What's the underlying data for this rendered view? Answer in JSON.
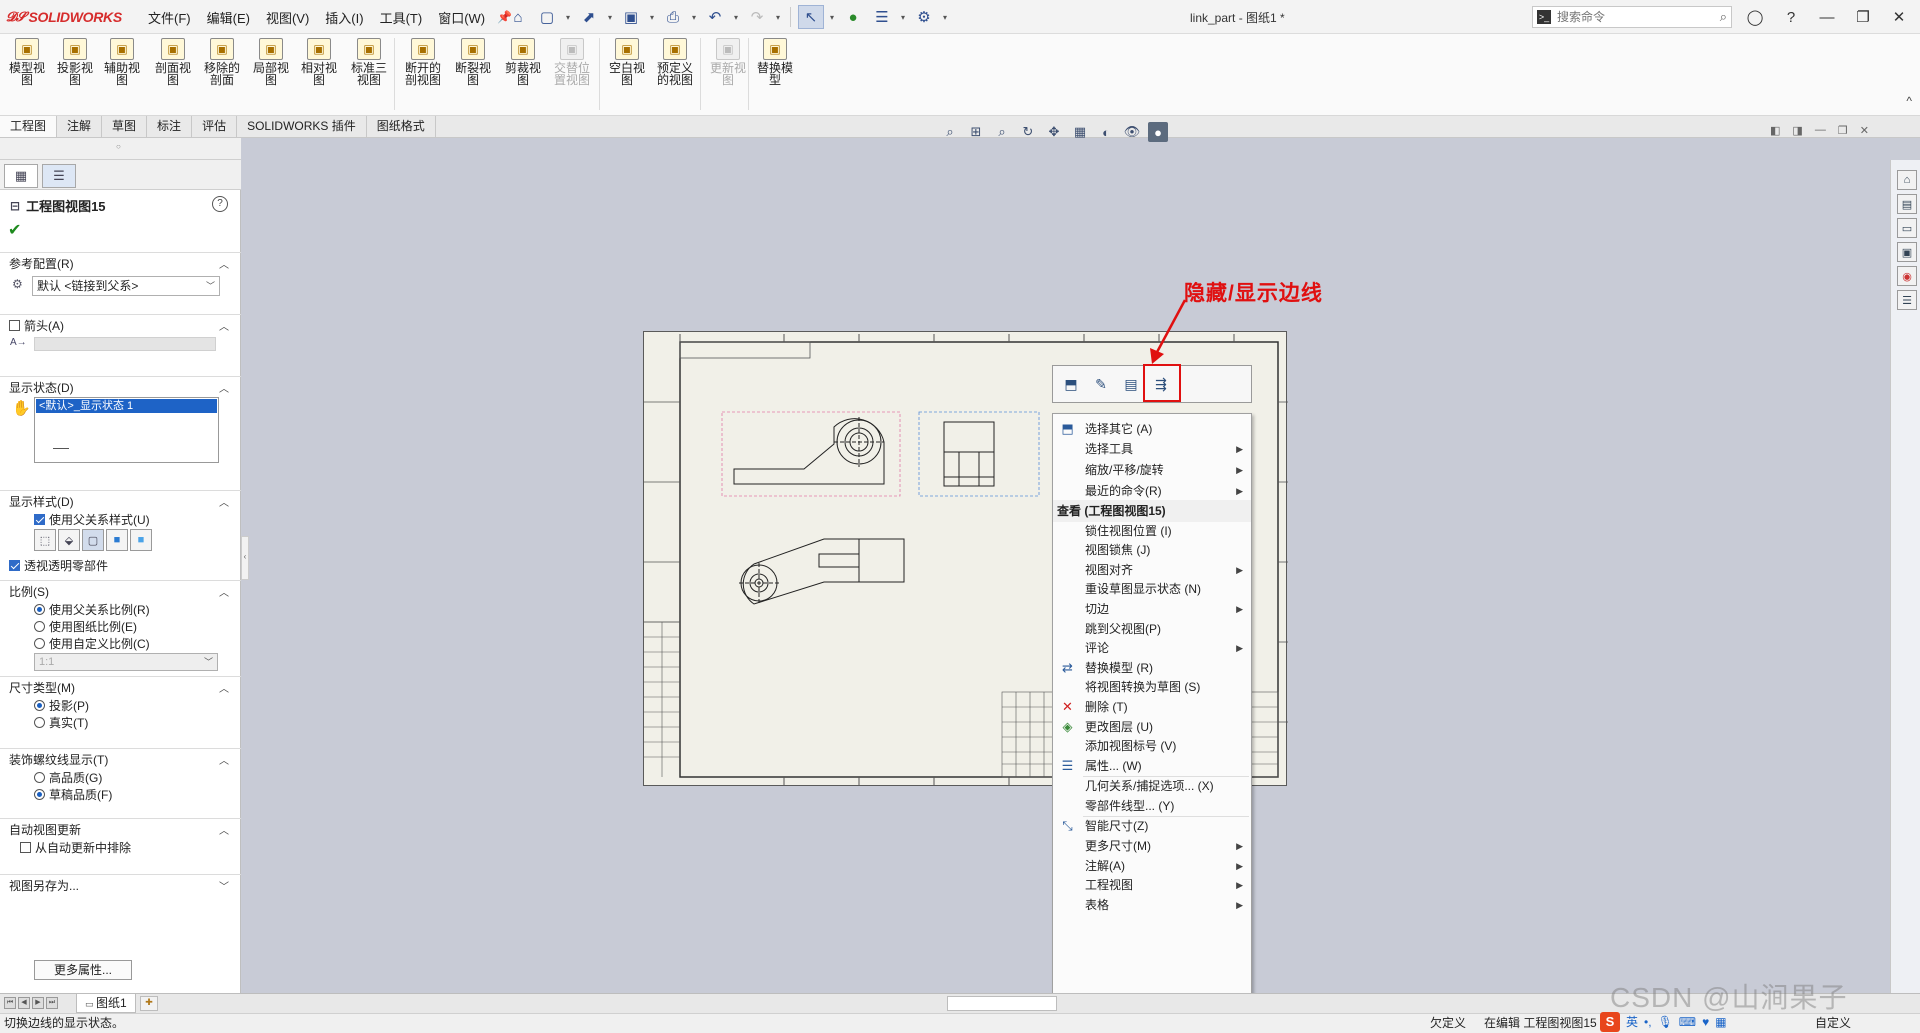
{
  "app": {
    "logo": "SOLIDWORKS",
    "doc_title": "link_part - 图纸1 *"
  },
  "menu": [
    "文件(F)",
    "编辑(E)",
    "视图(V)",
    "插入(I)",
    "工具(T)",
    "窗口(W)"
  ],
  "search": {
    "placeholder": "搜索命令"
  },
  "ribbon": [
    {
      "label": "模型视\n图",
      "icon": "model-view-icon",
      "disabled": false
    },
    {
      "label": "投影视\n图",
      "icon": "projected-view-icon",
      "disabled": false
    },
    {
      "label": "辅助视\n图",
      "icon": "auxiliary-view-icon",
      "disabled": false
    },
    {
      "label": "剖面视\n图",
      "icon": "section-view-icon",
      "disabled": false
    },
    {
      "label": "移除的\n剖面",
      "icon": "removed-section-icon",
      "disabled": false
    },
    {
      "label": "局部视\n图",
      "icon": "detail-view-icon",
      "disabled": false
    },
    {
      "label": "相对视\n图",
      "icon": "relative-view-icon",
      "disabled": false
    },
    {
      "label": "标准三\n视图",
      "icon": "standard-3-view-icon",
      "disabled": false
    },
    {
      "label": "断开的\n剖视图",
      "icon": "broken-out-section-icon",
      "disabled": false
    },
    {
      "label": "断裂视\n图",
      "icon": "break-view-icon",
      "disabled": false
    },
    {
      "label": "剪裁视\n图",
      "icon": "crop-view-icon",
      "disabled": false
    },
    {
      "label": "交替位\n置视图",
      "icon": "alternate-position-icon",
      "disabled": true
    },
    {
      "label": "空白视\n图",
      "icon": "empty-view-icon",
      "disabled": false
    },
    {
      "label": "预定义\n的视图",
      "icon": "predefined-view-icon",
      "disabled": false
    },
    {
      "label": "更新视\n图",
      "icon": "update-view-icon",
      "disabled": true
    },
    {
      "label": "替换模\n型",
      "icon": "replace-model-icon",
      "disabled": false
    }
  ],
  "tabs": [
    "工程图",
    "注解",
    "草图",
    "标注",
    "评估",
    "SOLIDWORKS 插件",
    "图纸格式"
  ],
  "panel": {
    "title": "工程图视图15",
    "help": "?",
    "ref_config": {
      "header": "参考配置(R)",
      "value": "默认 <链接到父系>"
    },
    "arrow": {
      "header": "箭头(A)"
    },
    "display_state": {
      "header": "显示状态(D)",
      "selected": "<默认>_显示状态 1"
    },
    "display_style": {
      "header": "显示样式(D)",
      "use_parent": "使用父关系样式(U)",
      "transparent": "透视透明零部件"
    },
    "scale": {
      "header": "比例(S)",
      "opt1": "使用父关系比例(R)",
      "opt2": "使用图纸比例(E)",
      "opt3": "使用自定义比例(C)",
      "custom_value": "1:1"
    },
    "dim_type": {
      "header": "尺寸类型(M)",
      "opt1": "投影(P)",
      "opt2": "真实(T)"
    },
    "thread": {
      "header": "装饰螺纹线显示(T)",
      "opt1": "高品质(G)",
      "opt2": "草稿品质(F)"
    },
    "auto_update": {
      "header": "自动视图更新",
      "exclude": "从自动更新中排除"
    },
    "save_as": {
      "header": "视图另存为..."
    },
    "more": "更多属性..."
  },
  "annotation": {
    "callout": "隐藏/显示边线"
  },
  "context_menu": {
    "items": [
      {
        "label": "选择其它 (A)",
        "icon": "select-other-icon",
        "sub": false,
        "header": false
      },
      {
        "label": "选择工具",
        "icon": "",
        "sub": true,
        "header": false
      },
      {
        "label": "缩放/平移/旋转",
        "icon": "",
        "sub": true,
        "header": false
      },
      {
        "label": "最近的命令(R)",
        "icon": "",
        "sub": true,
        "header": false
      },
      {
        "label": "查看 (工程图视图15)",
        "icon": "",
        "sub": false,
        "header": true
      },
      {
        "label": "锁住视图位置 (I)",
        "icon": "",
        "sub": false,
        "header": false
      },
      {
        "label": "视图锁焦 (J)",
        "icon": "",
        "sub": false,
        "header": false
      },
      {
        "label": "视图对齐",
        "icon": "",
        "sub": true,
        "header": false
      },
      {
        "label": "重设草图显示状态 (N)",
        "icon": "",
        "sub": false,
        "header": false
      },
      {
        "label": "切边",
        "icon": "",
        "sub": true,
        "header": false
      },
      {
        "label": "跳到父视图(P)",
        "icon": "",
        "sub": false,
        "header": false
      },
      {
        "label": "评论",
        "icon": "",
        "sub": true,
        "header": false
      },
      {
        "label": "替换模型 (R)",
        "icon": "replace-model-icon",
        "sub": false,
        "header": false
      },
      {
        "label": "将视图转换为草图 (S)",
        "icon": "",
        "sub": false,
        "header": false
      },
      {
        "label": "删除 (T)",
        "icon": "delete-icon",
        "sub": false,
        "header": false
      },
      {
        "label": "更改图层 (U)",
        "icon": "change-layer-icon",
        "sub": false,
        "header": false
      },
      {
        "label": "添加视图标号 (V)",
        "icon": "",
        "sub": false,
        "header": false
      },
      {
        "label": "属性... (W)",
        "icon": "properties-icon",
        "sub": false,
        "header": false
      },
      {
        "label": "几何关系/捕捉选项... (X)",
        "icon": "",
        "sub": false,
        "header": false
      },
      {
        "label": "零部件线型... (Y)",
        "icon": "",
        "sub": false,
        "header": false
      },
      {
        "label": "智能尺寸(Z)",
        "icon": "smart-dimension-icon",
        "sub": false,
        "header": false
      },
      {
        "label": "更多尺寸(M)",
        "icon": "",
        "sub": true,
        "header": false
      },
      {
        "label": "注解(A)",
        "icon": "",
        "sub": true,
        "header": false
      },
      {
        "label": "工程视图",
        "icon": "",
        "sub": true,
        "header": false
      },
      {
        "label": "表格",
        "icon": "",
        "sub": true,
        "header": false
      }
    ]
  },
  "sheet_tab": "图纸1",
  "status": {
    "left": "切换边线的显示状态。",
    "under_defined": "欠定义",
    "editing": "在编辑 工程图视图15",
    "custom": "自定义"
  },
  "ime": {
    "logo": "S",
    "lang": "英"
  },
  "watermark": "CSDN @山涧果子",
  "colors": {
    "accent": "#1e63c6",
    "callout": "#e01010",
    "sheet": "#f1f0e8",
    "viewport": "#c8cbd6"
  }
}
